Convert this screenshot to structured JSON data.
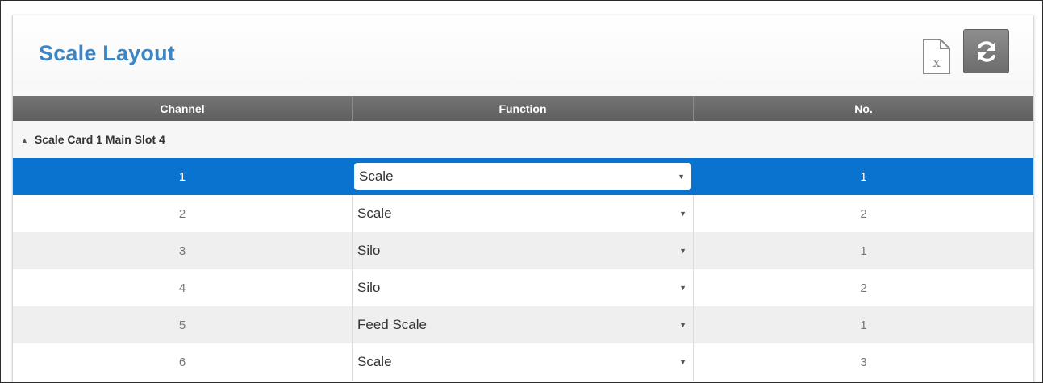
{
  "page": {
    "title": "Scale Layout",
    "export_icon": "excel-export-icon",
    "refresh_icon": "refresh-icon"
  },
  "table": {
    "columns": [
      "Channel",
      "Function",
      "No."
    ],
    "group_label": "Scale Card 1 Main Slot 4",
    "rows": [
      {
        "channel": "1",
        "function": "Scale",
        "no": "1",
        "selected": true
      },
      {
        "channel": "2",
        "function": "Scale",
        "no": "2",
        "selected": false
      },
      {
        "channel": "3",
        "function": "Silo",
        "no": "1",
        "selected": false
      },
      {
        "channel": "4",
        "function": "Silo",
        "no": "2",
        "selected": false
      },
      {
        "channel": "5",
        "function": "Feed Scale",
        "no": "1",
        "selected": false
      },
      {
        "channel": "6",
        "function": "Scale",
        "no": "3",
        "selected": false
      }
    ]
  },
  "colors": {
    "title": "#3d86c6",
    "selected_row": "#0a72cf",
    "header_bg": "#666666"
  }
}
